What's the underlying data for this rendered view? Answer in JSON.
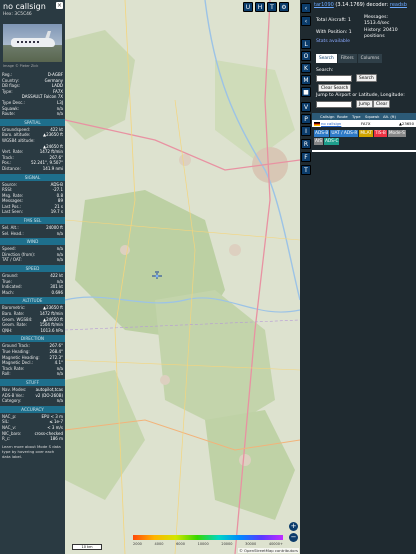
{
  "left": {
    "callsign": "no callsign",
    "hex_label": "Hex:",
    "hex": "3C5C46",
    "close": "×",
    "photo_credit": "Image © Pieter Zick",
    "ident": [
      {
        "k": "Reg.:",
        "v": "D-AGBF"
      },
      {
        "k": "Country:",
        "v": "Germany"
      },
      {
        "k": "DB flags:",
        "v": "LADD"
      },
      {
        "k": "Type:",
        "v": "FA7X"
      },
      {
        "k": "",
        "v": "DASSAULT Falcon 7X"
      },
      {
        "k": "Type Desc.:",
        "v": "L3J"
      },
      {
        "k": "Squawk:",
        "v": "n/a"
      },
      {
        "k": "Route:",
        "v": "n/a"
      }
    ],
    "spatial_title": "SPATIAL",
    "spatial": [
      {
        "k": "Groundspeed:",
        "v": "422 kt"
      },
      {
        "k": "Baro. altitude:",
        "v": "▲23650 ft"
      },
      {
        "k": "WGS84 altitude:",
        "v": ""
      },
      {
        "k": "",
        "v": "▲24650 ft"
      },
      {
        "k": "Vert. Rate:",
        "v": "1472 ft/min"
      },
      {
        "k": "Track:",
        "v": "267.6°"
      },
      {
        "k": "Pos.:",
        "v": "52.241°, 9.507°"
      },
      {
        "k": "Distance:",
        "v": "141.9 nmi"
      }
    ],
    "signal_title": "SIGNAL",
    "signal": [
      {
        "k": "Source:",
        "v": "ADS-B"
      },
      {
        "k": "RSSI:",
        "v": "-27.1"
      },
      {
        "k": "Msg. Rate:",
        "v": "0.8"
      },
      {
        "k": "Messages:",
        "v": "89"
      },
      {
        "k": "Last Pos.:",
        "v": "21 s"
      },
      {
        "k": "Last Seen:",
        "v": "19.7 s"
      }
    ],
    "fms_title": "FMS SEL",
    "fms": [
      {
        "k": "Sel. Alt.:",
        "v": "24000 ft"
      },
      {
        "k": "Sel. Head.:",
        "v": "n/a"
      }
    ],
    "wind_title": "WIND",
    "wind": [
      {
        "k": "Speed:",
        "v": "n/a"
      },
      {
        "k": "Direction (from):",
        "v": "n/a"
      },
      {
        "k": "TAT / OAT:",
        "v": "n/a"
      }
    ],
    "speed_title": "SPEED",
    "speed": [
      {
        "k": "Ground:",
        "v": "422 kt"
      },
      {
        "k": "True:",
        "v": "n/a"
      },
      {
        "k": "Indicated:",
        "v": "301 kt"
      },
      {
        "k": "Mach:",
        "v": "0.696"
      }
    ],
    "altitude_title": "ALTITUDE",
    "altitude": [
      {
        "k": "Barometric:",
        "v": "▲23650 ft"
      },
      {
        "k": "Baro. Rate:",
        "v": "1472 ft/min"
      },
      {
        "k": "Geom. WGS84:",
        "v": "▲24650 ft"
      },
      {
        "k": "Geom. Rate:",
        "v": "1504 ft/min"
      },
      {
        "k": "QNH:",
        "v": "1013.6 hPa"
      }
    ],
    "direction_title": "DIRECTION",
    "direction": [
      {
        "k": "Ground Track:",
        "v": "267.6°"
      },
      {
        "k": "True Heading:",
        "v": "268.4°"
      },
      {
        "k": "Magnetic Heading:",
        "v": "272.3°"
      },
      {
        "k": "Magnetic Decl.:",
        "v": "4.1°"
      },
      {
        "k": "Track Rate:",
        "v": "n/a"
      },
      {
        "k": "Roll:",
        "v": "n/a"
      }
    ],
    "stuff_title": "STUFF",
    "stuff": [
      {
        "k": "Nav. Modes:",
        "v": "autopilot,tcas"
      },
      {
        "k": "ADS-B Ver.:",
        "v": "v2 (DO-260B)"
      },
      {
        "k": "Category:",
        "v": "n/a"
      }
    ],
    "accuracy_title": "ACCURACY",
    "accuracy": [
      {
        "k": "NAC_p:",
        "v": "EPU < 3 m"
      },
      {
        "k": "SIL:",
        "v": "≤ 1e-7"
      },
      {
        "k": "NAC_v:",
        "v": "< 3 m/s"
      },
      {
        "k": "NIC_baro:",
        "v": "cross-checked"
      },
      {
        "k": "R_c:",
        "v": "186 m"
      }
    ],
    "learn_more": "Learn more about Mode S data type by hovering over each data label."
  },
  "map": {
    "top_buttons": [
      "U",
      "H",
      "T",
      "⚙"
    ],
    "zoom_in": "+",
    "zoom_out": "−",
    "scale": "10 km",
    "altitude_ticks": [
      "2000",
      "4000",
      "6000",
      "10000",
      "20000",
      "30000",
      "40000+"
    ],
    "attribution": "© OpenStreetMap contributors"
  },
  "strip": {
    "buttons": [
      "‹",
      "‹",
      "L",
      "O",
      "K",
      "M",
      "■",
      "V",
      "P",
      "I",
      "R",
      "F",
      "T"
    ]
  },
  "right": {
    "version_link": "tar1090",
    "version_text": "(3.14.1769) decoder:",
    "decoder_link": "readsb",
    "total_label": "Total Aircraft: 1",
    "position_label": "With Position: 1",
    "messages_label": "Messages:",
    "messages_value": "1513.4/sec",
    "history_label": "History: 20410 positions",
    "stats_label": "Stats available",
    "tabs": [
      "Search",
      "Filters",
      "Columns"
    ],
    "search_label": "Search:",
    "search_button": "Search",
    "clear_button": "Clear Search",
    "jump_label": "Jump to Airport or Latitude, Longitude:",
    "jump_button": "Jump",
    "clear2_button": "Clear",
    "table_headers": [
      "",
      "Callsign",
      "Route",
      "Type",
      "Squawk",
      "Alt. (ft)"
    ],
    "table_row": {
      "callsign": "no callsign",
      "type": "FA7X",
      "alt": "▲23650"
    },
    "badges": [
      {
        "t": "ADS-B",
        "c": "#2e7ac7"
      },
      {
        "t": "UAT / ADS-R",
        "c": "#2e7ac7"
      },
      {
        "t": "MLAT",
        "c": "#cfa300"
      },
      {
        "t": "TIS-B",
        "c": "#e34"
      },
      {
        "t": "Mode-S",
        "c": "#888"
      },
      {
        "t": "AIS",
        "c": "#888"
      },
      {
        "t": "ADS-C",
        "c": "#1e9f8c"
      }
    ]
  }
}
